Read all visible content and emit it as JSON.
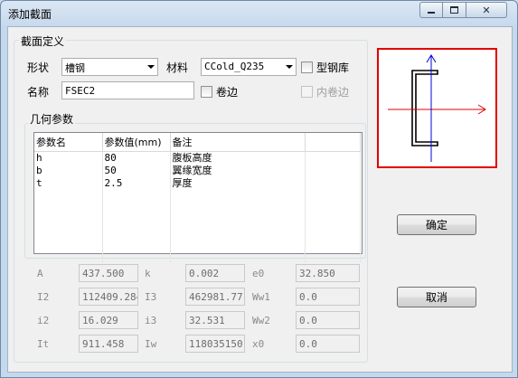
{
  "window": {
    "title": "添加截面"
  },
  "definition": {
    "group_label": "截面定义",
    "shape_label": "形状",
    "shape_value": "槽钢",
    "material_label": "材料",
    "material_value": "CCold_Q235",
    "steel_lib_label": "型钢库",
    "name_label": "名称",
    "name_value": "FSEC2",
    "curl_edge_label": "卷边",
    "inner_curl_label": "内卷边"
  },
  "geometry": {
    "group_label": "几何参数",
    "columns": [
      "参数名",
      "参数值(mm)",
      "备注"
    ],
    "rows": [
      {
        "name": "h",
        "value": "80",
        "note": "腹板高度"
      },
      {
        "name": "b",
        "value": "50",
        "note": "翼缘宽度"
      },
      {
        "name": "t",
        "value": "2.5",
        "note": "厚度"
      }
    ]
  },
  "properties": [
    {
      "label": "A",
      "value": "437.500"
    },
    {
      "label": "k",
      "value": "0.002"
    },
    {
      "label": "e0",
      "value": "32.850"
    },
    {
      "label": "I2",
      "value": "112409.284"
    },
    {
      "label": "I3",
      "value": "462981.771"
    },
    {
      "label": "Ww1",
      "value": "0.0"
    },
    {
      "label": "i2",
      "value": "16.029"
    },
    {
      "label": "i3",
      "value": "32.531"
    },
    {
      "label": "Ww2",
      "value": "0.0"
    },
    {
      "label": "It",
      "value": "911.458"
    },
    {
      "label": "Iw",
      "value": "118035150."
    },
    {
      "label": "x0",
      "value": "0.0"
    }
  ],
  "buttons": {
    "ok": "确定",
    "cancel": "取消"
  },
  "colors": {
    "preview_border": "#e00000",
    "x_axis": "#e00000",
    "y_axis": "#0000e0"
  }
}
